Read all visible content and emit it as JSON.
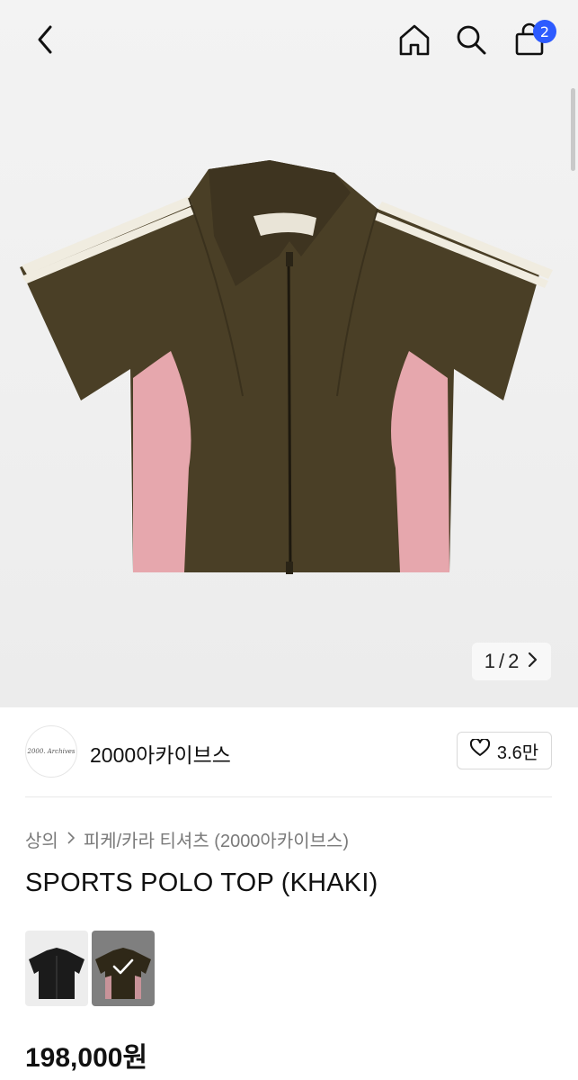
{
  "header": {
    "cart_count": "2",
    "icons": [
      "chevron-left-icon",
      "home-icon",
      "search-icon",
      "shopping-bag-icon"
    ]
  },
  "gallery": {
    "current": "1",
    "sep": "/",
    "total": "2"
  },
  "brand": {
    "name": "2000아카이브스",
    "logo_text": "2000. Archives",
    "likes": "3.6만"
  },
  "breadcrumb": {
    "category": "상의",
    "subcategory": "피케/카라 티셔츠 (2000아카이브스)"
  },
  "product": {
    "title": "SPORTS POLO TOP (KHAKI)",
    "price": "198,000원",
    "colors": {
      "khaki": "#4a3f26",
      "pink": "#e6a7ad",
      "stripe": "#f0ece0",
      "black": "#1b1b1b",
      "badge": "#2d5bff"
    }
  }
}
